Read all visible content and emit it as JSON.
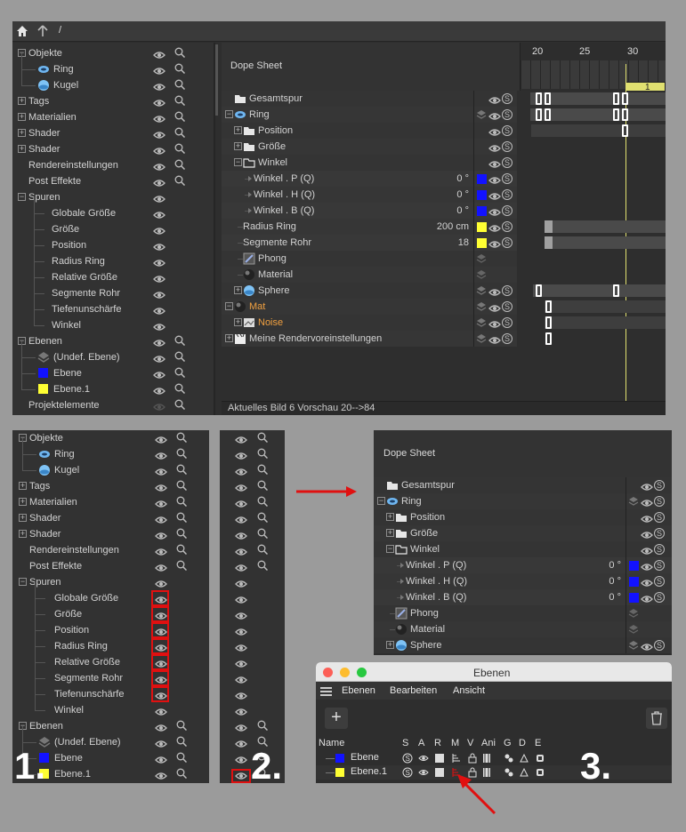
{
  "colors": {
    "panel_bg": "#333333",
    "accent_orange": "#f0a040",
    "layer_blue": "#1212ff",
    "layer_yellow": "#ffff33",
    "highlight_red": "#e01010",
    "timeline_yellow": "#e0e070"
  },
  "top": {
    "breadcrumb": "/",
    "tree": [
      {
        "label": "Objekte",
        "depth": 0,
        "box": "−",
        "eye": true,
        "mag": true
      },
      {
        "label": "Ring",
        "depth": 1,
        "icon": "ring",
        "eye": true,
        "mag": true
      },
      {
        "label": "Kugel",
        "depth": 1,
        "icon": "sphere",
        "eye": true,
        "mag": true
      },
      {
        "label": "Tags",
        "depth": 0,
        "box": "+",
        "eye": true,
        "mag": true
      },
      {
        "label": "Materialien",
        "depth": 0,
        "box": "+",
        "eye": true,
        "mag": true
      },
      {
        "label": "Shader",
        "depth": 0,
        "box": "+",
        "eye": true,
        "mag": true
      },
      {
        "label": "Shader",
        "depth": 0,
        "box": "+",
        "eye": true,
        "mag": true
      },
      {
        "label": "Rendereinstellungen",
        "depth": 0,
        "eye": true,
        "mag": true
      },
      {
        "label": "Post Effekte",
        "depth": 0,
        "eye": true,
        "mag": true
      },
      {
        "label": "Spuren",
        "depth": 0,
        "box": "−",
        "eye": true,
        "mag": false
      },
      {
        "label": "Globale Größe",
        "depth": 2,
        "eye": true
      },
      {
        "label": "Größe",
        "depth": 2,
        "eye": true
      },
      {
        "label": "Position",
        "depth": 2,
        "eye": true
      },
      {
        "label": "Radius Ring",
        "depth": 2,
        "eye": true
      },
      {
        "label": "Relative Größe",
        "depth": 2,
        "eye": true
      },
      {
        "label": "Segmente Rohr",
        "depth": 2,
        "eye": true
      },
      {
        "label": "Tiefenunschärfe",
        "depth": 2,
        "eye": true
      },
      {
        "label": "Winkel",
        "depth": 2,
        "eye": true
      },
      {
        "label": "Ebenen",
        "depth": 0,
        "box": "−",
        "eye": true,
        "mag": true
      },
      {
        "label": "(Undef. Ebene)",
        "depth": 1,
        "icon": "layer-gray",
        "eye": true,
        "mag": true
      },
      {
        "label": "Ebene",
        "depth": 1,
        "icon": "blue",
        "eye": true,
        "mag": true
      },
      {
        "label": "Ebene.1",
        "depth": 1,
        "icon": "yellow",
        "eye": true,
        "mag": true
      },
      {
        "label": "Projektelemente",
        "depth": 0,
        "eye": false,
        "mag": true
      }
    ],
    "dope_title": "Dope Sheet",
    "ruler": [
      "20",
      "25",
      "30"
    ],
    "marker": "1",
    "rows": [
      {
        "label": "Gesamtspur",
        "depth": 0,
        "icon": "folder",
        "value": ""
      },
      {
        "label": "Ring",
        "depth": 0,
        "box": "−",
        "icon": "ring",
        "value": ""
      },
      {
        "label": "Position",
        "depth": 1,
        "box": "+",
        "icon": "folder",
        "value": ""
      },
      {
        "label": "Größe",
        "depth": 1,
        "box": "+",
        "icon": "folder",
        "value": ""
      },
      {
        "label": "Winkel",
        "depth": 1,
        "box": "−",
        "icon": "folder-open",
        "value": ""
      },
      {
        "label": "Winkel . P  (Q)",
        "depth": 2,
        "value": "0 °",
        "swatch": "blue"
      },
      {
        "label": "Winkel . H  (Q)",
        "depth": 2,
        "value": "0 °",
        "swatch": "blue"
      },
      {
        "label": "Winkel . B  (Q)",
        "depth": 2,
        "value": "0 °",
        "swatch": "blue"
      },
      {
        "label": "Radius Ring",
        "depth": 1,
        "value": "200 cm",
        "swatch": "yellow"
      },
      {
        "label": "Segmente Rohr",
        "depth": 1,
        "value": "18",
        "swatch": "yellow"
      },
      {
        "label": "Phong",
        "depth": 1,
        "icon": "phong",
        "value": ""
      },
      {
        "label": "Material",
        "depth": 1,
        "icon": "material",
        "value": ""
      },
      {
        "label": "Sphere",
        "depth": 1,
        "box": "+",
        "icon": "sphere",
        "value": ""
      },
      {
        "label": "Mat",
        "depth": 0,
        "box": "−",
        "icon": "material",
        "value": "",
        "orange": true
      },
      {
        "label": "Noise",
        "depth": 1,
        "box": "+",
        "icon": "noise",
        "value": "",
        "orange": true
      },
      {
        "label": "Meine Rendervoreinstellungen",
        "depth": 0,
        "box": "+",
        "icon": "clapper",
        "value": ""
      }
    ],
    "status": "Aktuelles Bild  6  Vorschau  20-->84"
  },
  "bottom_left": {
    "step": "1.",
    "tree": [
      {
        "label": "Objekte",
        "depth": 0,
        "box": "−",
        "mag": true
      },
      {
        "label": "Ring",
        "depth": 1,
        "icon": "ring",
        "mag": true
      },
      {
        "label": "Kugel",
        "depth": 1,
        "icon": "sphere",
        "mag": true
      },
      {
        "label": "Tags",
        "depth": 0,
        "box": "+",
        "mag": true
      },
      {
        "label": "Materialien",
        "depth": 0,
        "box": "+",
        "mag": true
      },
      {
        "label": "Shader",
        "depth": 0,
        "box": "+",
        "mag": true
      },
      {
        "label": "Shader",
        "depth": 0,
        "box": "+",
        "mag": true
      },
      {
        "label": "Rendereinstellungen",
        "depth": 0,
        "mag": true
      },
      {
        "label": "Post Effekte",
        "depth": 0,
        "mag": true
      },
      {
        "label": "Spuren",
        "depth": 0,
        "box": "−"
      },
      {
        "label": "Globale Größe",
        "depth": 2,
        "red": true
      },
      {
        "label": "Größe",
        "depth": 2,
        "red": true
      },
      {
        "label": "Position",
        "depth": 2,
        "red": true
      },
      {
        "label": "Radius Ring",
        "depth": 2,
        "red": true
      },
      {
        "label": "Relative Größe",
        "depth": 2,
        "red": true
      },
      {
        "label": "Segmente Rohr",
        "depth": 2,
        "red": true
      },
      {
        "label": "Tiefenunschärfe",
        "depth": 2,
        "red": true
      },
      {
        "label": "Winkel",
        "depth": 2
      },
      {
        "label": "Ebenen",
        "depth": 0,
        "box": "−",
        "mag": true
      },
      {
        "label": "(Undef. Ebene)",
        "depth": 1,
        "icon": "layer-gray",
        "mag": true
      },
      {
        "label": "Ebene",
        "depth": 1,
        "icon": "blue",
        "mag": true
      },
      {
        "label": "Ebene.1",
        "depth": 1,
        "icon": "yellow",
        "mag": true
      }
    ]
  },
  "bottom_mid": {
    "step": "2."
  },
  "bottom_right": {
    "dope_title": "Dope Sheet",
    "rows": [
      {
        "label": "Gesamtspur",
        "depth": 0,
        "icon": "folder",
        "value": ""
      },
      {
        "label": "Ring",
        "depth": 0,
        "box": "−",
        "icon": "ring",
        "value": ""
      },
      {
        "label": "Position",
        "depth": 1,
        "box": "+",
        "icon": "folder",
        "value": ""
      },
      {
        "label": "Größe",
        "depth": 1,
        "box": "+",
        "icon": "folder",
        "value": ""
      },
      {
        "label": "Winkel",
        "depth": 1,
        "box": "−",
        "icon": "folder-open",
        "value": ""
      },
      {
        "label": "Winkel . P  (Q)",
        "depth": 2,
        "value": "0 °",
        "swatch": "blue"
      },
      {
        "label": "Winkel . H  (Q)",
        "depth": 2,
        "value": "0 °",
        "swatch": "blue"
      },
      {
        "label": "Winkel . B  (Q)",
        "depth": 2,
        "value": "0 °",
        "swatch": "blue"
      },
      {
        "label": "Phong",
        "depth": 1,
        "icon": "phong",
        "value": ""
      },
      {
        "label": "Material",
        "depth": 1,
        "icon": "material",
        "value": ""
      },
      {
        "label": "Sphere",
        "depth": 1,
        "box": "+",
        "icon": "sphere",
        "value": ""
      }
    ]
  },
  "layers_window": {
    "title": "Ebenen",
    "menu": [
      "Ebenen",
      "Bearbeiten",
      "Ansicht"
    ],
    "columns": [
      "Name",
      "S",
      "A",
      "R",
      "M",
      "V",
      "Ani",
      "G",
      "D",
      "E"
    ],
    "layers": [
      {
        "name": "Ebene",
        "color": "blue"
      },
      {
        "name": "Ebene.1",
        "color": "yellow"
      }
    ],
    "step": "3."
  }
}
